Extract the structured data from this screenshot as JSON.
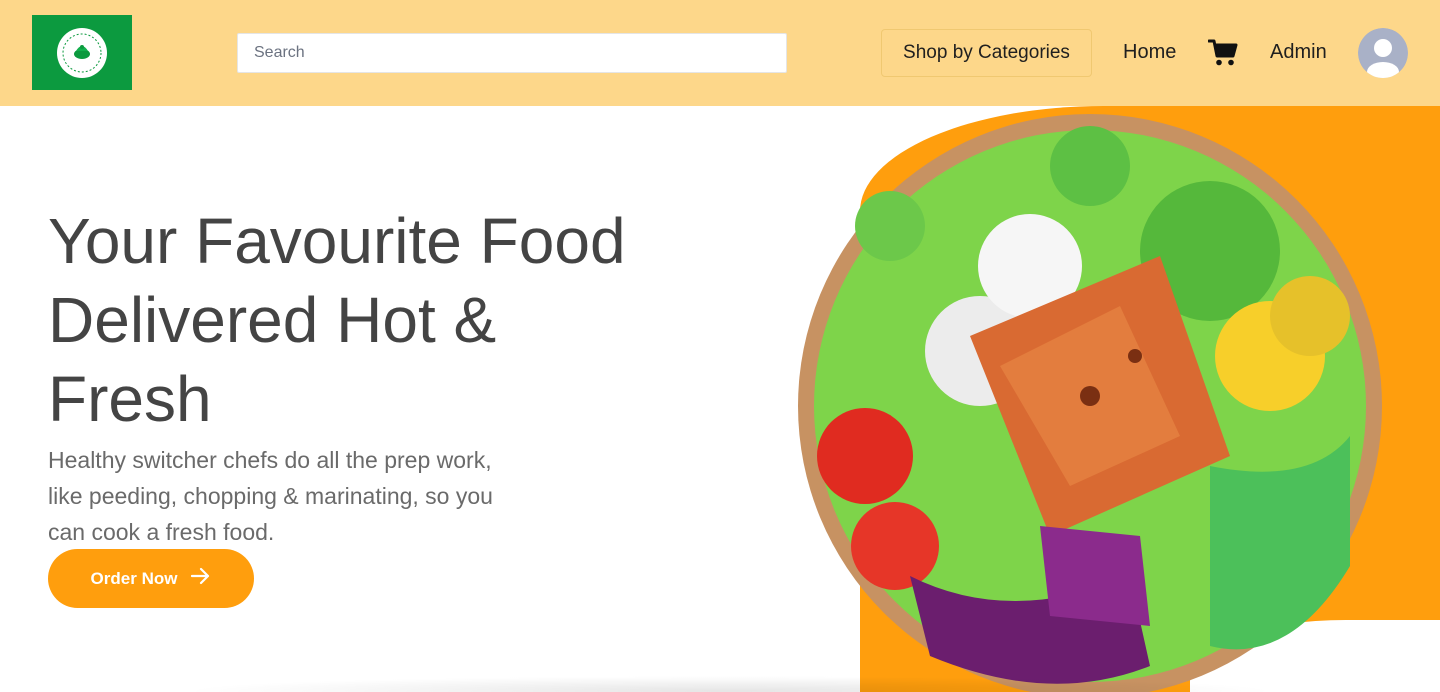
{
  "header": {
    "search": {
      "placeholder": "Search",
      "value": ""
    },
    "categories_label": "Shop by Categories",
    "home_label": "Home",
    "admin_label": "Admin"
  },
  "hero": {
    "title_line1": "Your Favourite Food",
    "title_line2": "Delivered Hot &",
    "title_line3": "Fresh",
    "description_line1": "Healthy switcher chefs do all the prep work,",
    "description_line2": "like peeding, chopping & marinating, so you",
    "description_line3": "can cook a fresh food.",
    "cta_label": "Order Now"
  },
  "icons": {
    "logo": "leaf-logo-icon",
    "cart": "shopping-cart-icon",
    "avatar": "user-avatar-icon",
    "cta_arrow": "arrow-right-icon"
  },
  "colors": {
    "header_bg": "#fdd78a",
    "logo_bg": "#0c9a3f",
    "accent": "#ff9e0d",
    "title_text": "#444444",
    "body_text": "#6a6a6a"
  }
}
